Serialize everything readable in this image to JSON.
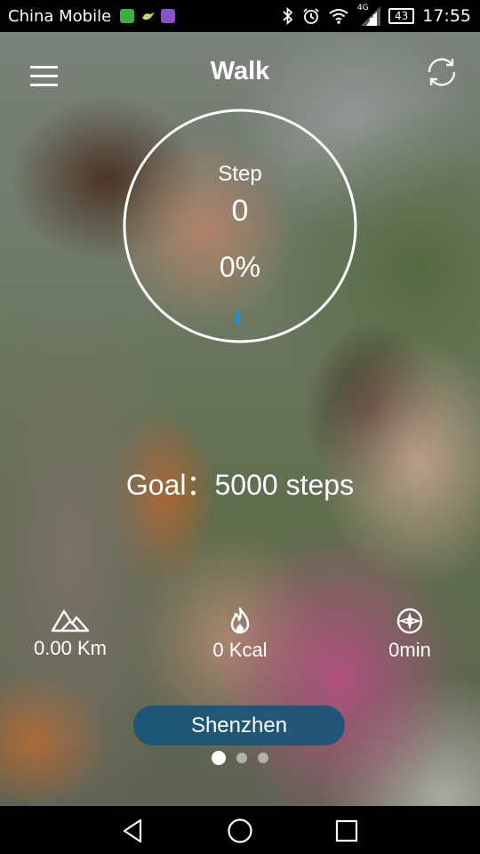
{
  "status_bar": {
    "carrier": "China Mobile",
    "network_badge": "4G",
    "battery": "43",
    "time": "17:55",
    "icons": [
      "app-green-icon",
      "app-bird-icon",
      "app-purple-icon",
      "bluetooth-icon",
      "alarm-icon",
      "wifi-icon",
      "cell-signal-icon",
      "battery-icon"
    ]
  },
  "header": {
    "title": "Walk",
    "left_icon": "menu-icon",
    "right_icon": "sync-icon"
  },
  "progress": {
    "label": "Step",
    "steps": "0",
    "percent_text": "0%",
    "fraction": 0.0,
    "ring_color": "#ffffff",
    "marker_color": "#1e8fe0"
  },
  "goal": {
    "text": "Goal：5000 steps"
  },
  "stats": {
    "distance": {
      "icon": "mountain-icon",
      "value": "0.00 Km"
    },
    "calories": {
      "icon": "flame-icon",
      "value": "0 Kcal"
    },
    "duration": {
      "icon": "compass-icon",
      "value": "0min"
    }
  },
  "location": {
    "city": "Shenzhen",
    "pill_color": "#15547a"
  },
  "pager": {
    "count": 3,
    "active_index": 0
  },
  "nav_bar": {
    "icons": [
      "back-icon",
      "home-icon",
      "recents-icon"
    ]
  }
}
